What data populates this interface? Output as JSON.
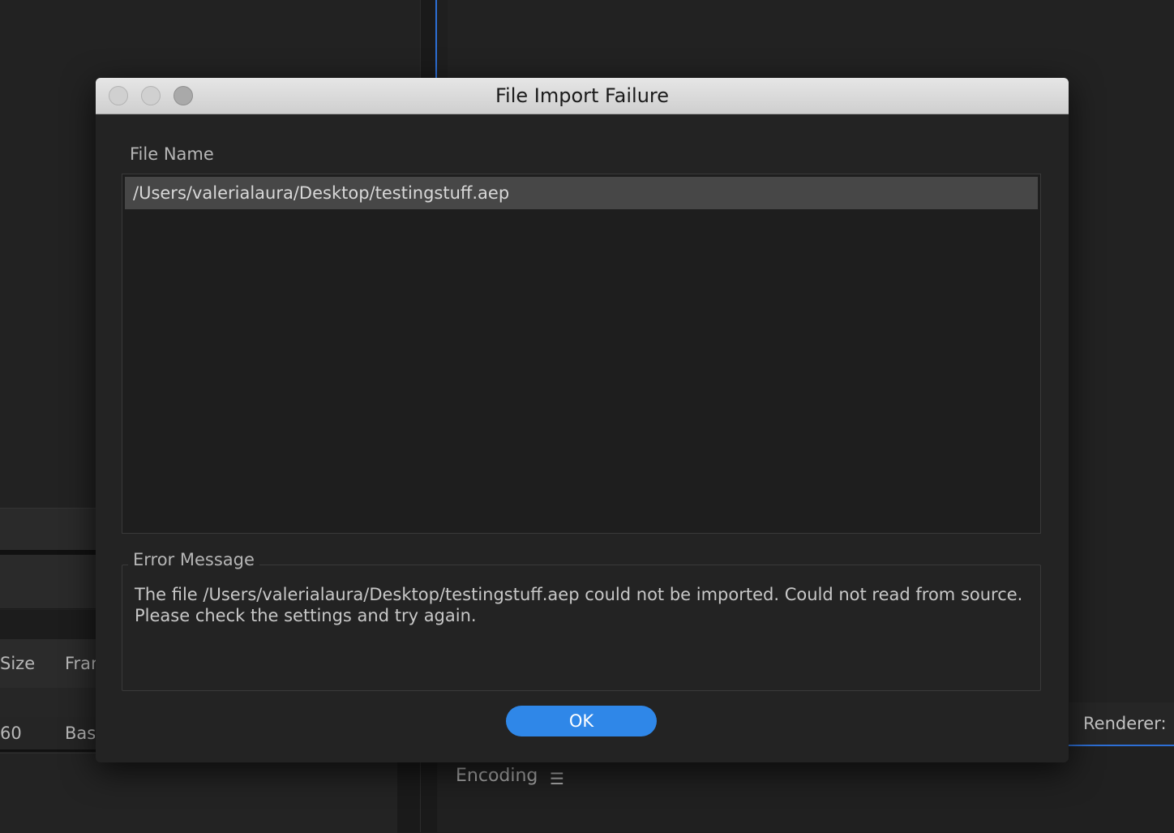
{
  "background": {
    "table_headers": [
      "Size",
      "Frar"
    ],
    "table_row": [
      "60",
      "Bas"
    ],
    "encoding_label": "Encoding",
    "renderer_label": "Renderer:",
    "accent_color": "#2d6fd6"
  },
  "dialog": {
    "title": "File Import Failure",
    "file_name_label": "File Name",
    "files": [
      "/Users/valerialaura/Desktop/testingstuff.aep"
    ],
    "error_label": "Error Message",
    "error_message": "The file /Users/valerialaura/Desktop/testingstuff.aep could not be imported. Could not read from source. Please check the settings and try again.",
    "ok_label": "OK",
    "ok_color": "#2f87e8"
  }
}
